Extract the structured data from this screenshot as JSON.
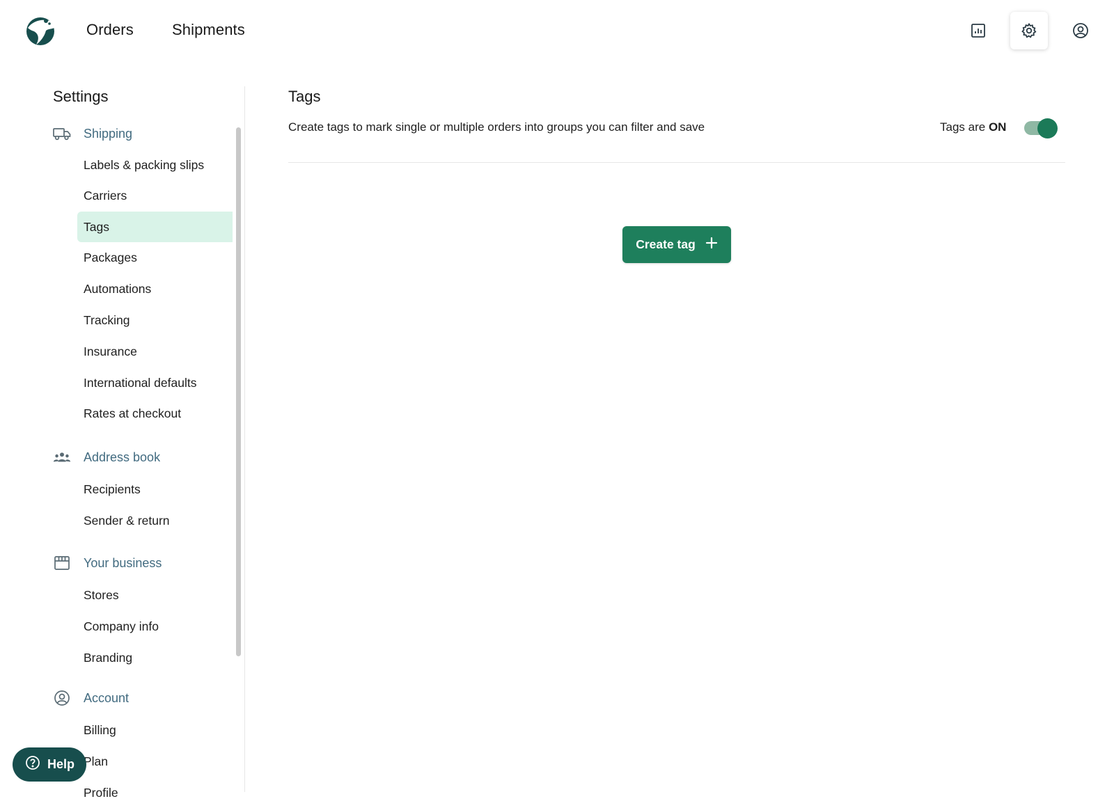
{
  "header": {
    "nav": {
      "orders": "Orders",
      "shipments": "Shipments"
    },
    "icons": [
      "reports-icon",
      "settings-icon",
      "account-icon"
    ]
  },
  "sidebar": {
    "title": "Settings",
    "sections": [
      {
        "label": "Shipping",
        "icon": "truck-icon",
        "items": [
          "Labels & packing slips",
          "Carriers",
          "Tags",
          "Packages",
          "Automations",
          "Tracking",
          "Insurance",
          "International defaults",
          "Rates at checkout"
        ]
      },
      {
        "label": "Address book",
        "icon": "people-icon",
        "items": [
          "Recipients",
          "Sender & return"
        ]
      },
      {
        "label": "Your business",
        "icon": "store-icon",
        "items": [
          "Stores",
          "Company info",
          "Branding"
        ]
      },
      {
        "label": "Account",
        "icon": "account-circle-icon",
        "items": [
          "Billing",
          "Plan",
          "Profile"
        ]
      }
    ],
    "active_item": "Tags"
  },
  "main": {
    "title": "Tags",
    "description": "Create tags to mark single or multiple orders into groups you can filter and save",
    "toggle_prefix": "Tags are",
    "toggle_state": "ON",
    "toggle_on": true,
    "create_button": "Create tag"
  },
  "help": {
    "label": "Help"
  },
  "colors": {
    "section_heading": "#426b80",
    "active_bg": "#d9f3e8",
    "primary_button": "#1e7f5c",
    "toggle_knob": "#1b7a58",
    "help_button": "#174e4d",
    "logo": "#174e4d"
  }
}
